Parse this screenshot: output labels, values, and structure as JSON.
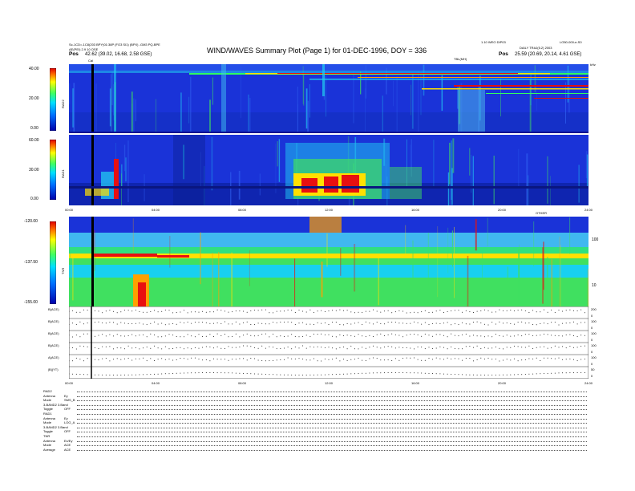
{
  "header": {
    "title": "WIND/WAVES Summary Plot (Page 1) for 01-DEC-1996, DOY = 336",
    "left_line1": "Sc-1CD=-1C8(203 BPY)01:38P (FO3 SI1) (BPX) -GM3 PQ-BPE",
    "left_line2": "AE(PEI) 2.9 10 OSE",
    "left_pos_label": "Pos",
    "left_pos_value": "42.62 (39.02, 16.68, 2.58 GSE)",
    "right_line1": "1.10 WEO DIP03",
    "right_line2": "LO50-000-e-S0",
    "right_line3": "DAILY TRAJ(5.2) 2003",
    "right_pos_label": "Pos",
    "right_pos_value": "25.59 (20.69, 20.14, 4.61 GSE)",
    "mid_label": "TBL(MH)",
    "cal_label": "Cal"
  },
  "panels": {
    "rad2": {
      "label": "RAD2",
      "cb_ticks": [
        "40.00",
        "20.00",
        "0.00"
      ]
    },
    "rad1": {
      "label": "RAD1",
      "cb_ticks": [
        "60.00",
        "30.00",
        "0.00"
      ]
    },
    "tnr": {
      "label": "TNR",
      "cb_ticks": [
        "-120.00",
        "-137.50",
        "-155.00"
      ],
      "right_ticks": [
        "100",
        "10"
      ]
    },
    "right_top": "kHz",
    "ut_label": "OTHER"
  },
  "line_panels": [
    {
      "label": "B(ACE)",
      "right": [
        "200",
        "0"
      ]
    },
    {
      "label": "B(ACE)",
      "right": [
        "100",
        "0"
      ]
    },
    {
      "label": "B(ACE)",
      "right": [
        "100",
        "0"
      ]
    },
    {
      "label": "B(ACE)",
      "right": [
        "100",
        "0"
      ]
    },
    {
      "label": "A(ACE)",
      "right": [
        "100",
        "0"
      ]
    },
    {
      "label": "|B|(YT)",
      "right": [
        "50",
        "0"
      ]
    }
  ],
  "time_axis": [
    "00:00",
    "04:00",
    "08:00",
    "12:00",
    "16:00",
    "20:00",
    "24:00"
  ],
  "notes": [
    {
      "label": "RAD2",
      "val": ""
    },
    {
      "label": "Antenna",
      "val": "Ey"
    },
    {
      "label": "Mode",
      "val": "SMS_B"
    },
    {
      "label": "3-BAND2 3.Band",
      "val": ""
    },
    {
      "label": "Toggle",
      "val": "OFF"
    },
    {
      "label": "RAD1",
      "val": ""
    },
    {
      "label": "Antenna",
      "val": "Ey"
    },
    {
      "label": "Mode",
      "val": "LOG_A"
    },
    {
      "label": "3-BAND2 3.Band",
      "val": ""
    },
    {
      "label": "Toggle",
      "val": "OFF"
    },
    {
      "label": "TNR",
      "val": ""
    },
    {
      "label": "Antenna",
      "val": "Ex/Ey"
    },
    {
      "label": "Mode",
      "val": "ACE"
    },
    {
      "label": "Average",
      "val": "ACE"
    }
  ],
  "colors": {
    "bg_blue": "#1a2fd6",
    "bg_cyan": "#18c8f0",
    "tnr_green": "#40e060",
    "burst_red": "#e81010",
    "burst_yellow": "#f0f010"
  },
  "chart_data": {
    "type": "heatmap",
    "title": "WIND/WAVES Summary Plot (Page 1) for 01-DEC-1996, DOY = 336",
    "x_ticks": [
      "00:00",
      "04:00",
      "08:00",
      "12:00",
      "16:00",
      "20:00",
      "24:00"
    ],
    "x_range_hours": [
      0,
      24
    ],
    "panels": [
      {
        "name": "RAD2",
        "colorbar_range": [
          0,
          40
        ]
      },
      {
        "name": "RAD1",
        "colorbar_range": [
          0,
          60
        ]
      },
      {
        "name": "TNR",
        "colorbar_range": [
          -155,
          -120
        ],
        "y_ticks": [
          "100",
          "10"
        ]
      }
    ],
    "line_panels": [
      "B(ACE)",
      "B(ACE)",
      "B(ACE)",
      "B(ACE)",
      "A(ACE)",
      "|B|(YT)"
    ]
  }
}
